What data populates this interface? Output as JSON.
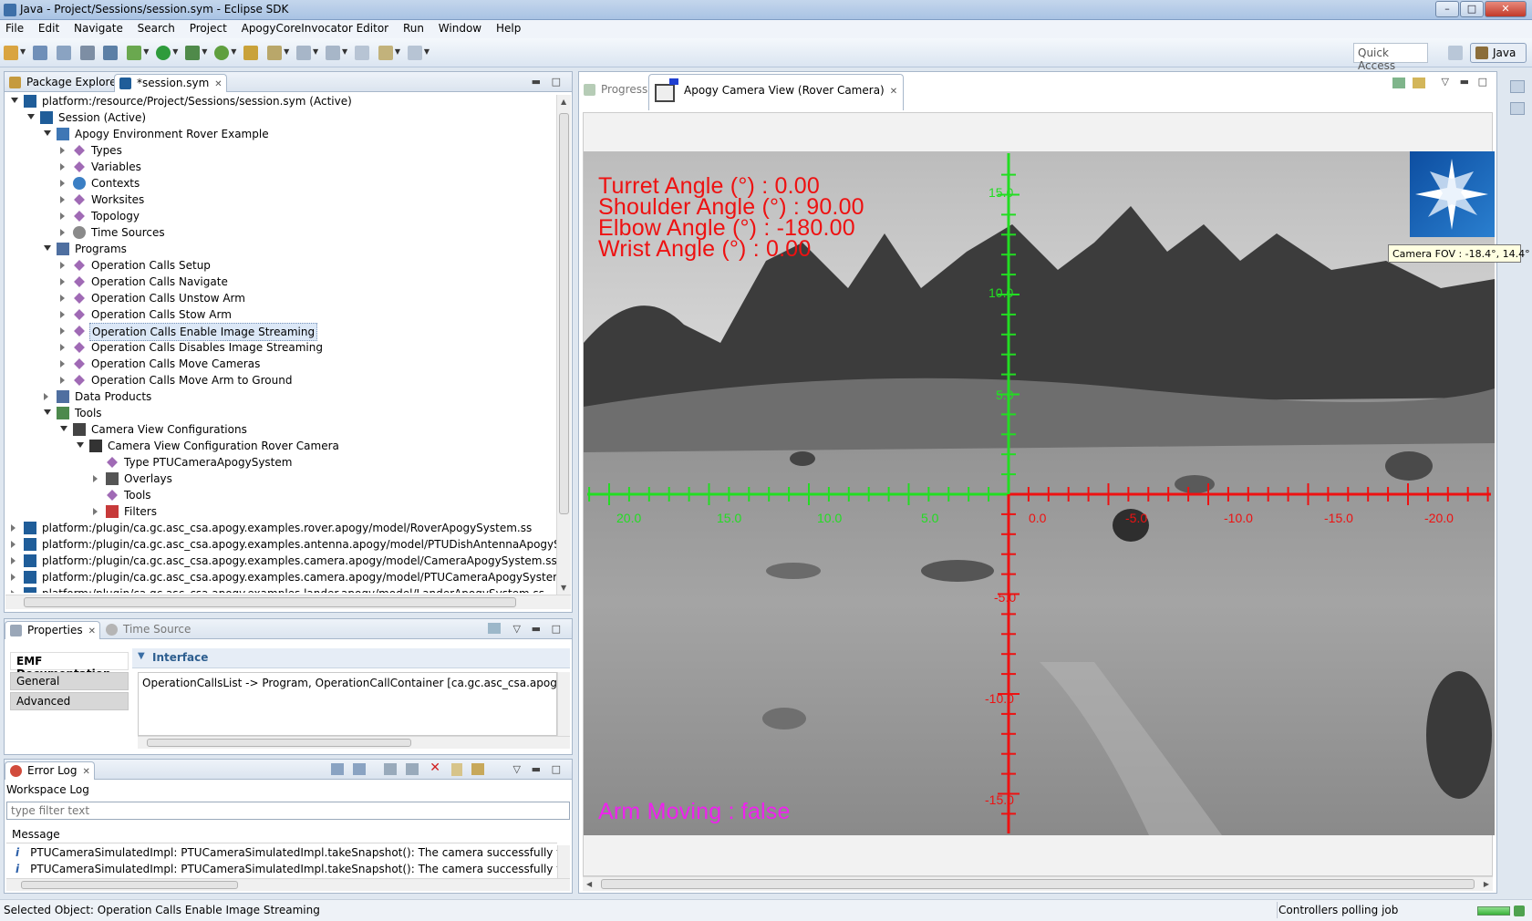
{
  "window": {
    "title": "Java - Project/Sessions/session.sym - Eclipse SDK",
    "min": "–",
    "max": "□",
    "close": "✕"
  },
  "menu": [
    "File",
    "Edit",
    "Navigate",
    "Search",
    "Project",
    "ApogyCoreInvocator Editor",
    "Run",
    "Window",
    "Help"
  ],
  "toolbar": {
    "quick_access": "Quick Access",
    "perspective": "Java"
  },
  "left_panel": {
    "tabs": [
      {
        "label": "Package Explorer"
      },
      {
        "label": "*session.sym"
      }
    ],
    "tree": [
      {
        "label": "platform:/resource/Project/Sessions/session.sym (Active)",
        "depth": 0,
        "state": "open",
        "icon": "apogy-icon"
      },
      {
        "label": "Session (Active)",
        "depth": 1,
        "state": "open",
        "icon": "apogy-icon"
      },
      {
        "label": "Apogy Environment Rover Example",
        "depth": 2,
        "state": "open",
        "icon": "environment-icon"
      },
      {
        "label": "Types",
        "depth": 3,
        "state": "closed",
        "icon": "diamond-icon"
      },
      {
        "label": "Variables",
        "depth": 3,
        "state": "closed",
        "icon": "diamond-icon"
      },
      {
        "label": "Contexts",
        "depth": 3,
        "state": "closed",
        "icon": "globe-icon"
      },
      {
        "label": "Worksites",
        "depth": 3,
        "state": "closed",
        "icon": "diamond-icon"
      },
      {
        "label": "Topology",
        "depth": 3,
        "state": "closed",
        "icon": "diamond-icon"
      },
      {
        "label": "Time Sources",
        "depth": 3,
        "state": "closed",
        "icon": "clock-icon"
      },
      {
        "label": "Programs",
        "depth": 2,
        "state": "open",
        "icon": "programs-icon"
      },
      {
        "label": "Operation Calls Setup",
        "depth": 3,
        "state": "closed",
        "icon": "diamond-icon"
      },
      {
        "label": "Operation Calls Navigate",
        "depth": 3,
        "state": "closed",
        "icon": "diamond-icon"
      },
      {
        "label": "Operation Calls Unstow Arm",
        "depth": 3,
        "state": "closed",
        "icon": "diamond-icon"
      },
      {
        "label": "Operation Calls Stow Arm",
        "depth": 3,
        "state": "closed",
        "icon": "diamond-icon"
      },
      {
        "label": "Operation Calls Enable Image Streaming",
        "depth": 3,
        "state": "closed",
        "icon": "diamond-icon",
        "selected": true
      },
      {
        "label": "Operation Calls Disables Image Streaming",
        "depth": 3,
        "state": "closed",
        "icon": "diamond-icon"
      },
      {
        "label": "Operation Calls Move Cameras",
        "depth": 3,
        "state": "closed",
        "icon": "diamond-icon"
      },
      {
        "label": "Operation Calls Move Arm to Ground",
        "depth": 3,
        "state": "closed",
        "icon": "diamond-icon"
      },
      {
        "label": "Data Products",
        "depth": 2,
        "state": "closed",
        "icon": "data-products-icon"
      },
      {
        "label": "Tools",
        "depth": 2,
        "state": "open",
        "icon": "tools-icon"
      },
      {
        "label": "Camera View Configurations",
        "depth": 3,
        "state": "open",
        "icon": "camera-config-icon"
      },
      {
        "label": "Camera View Configuration Rover Camera",
        "depth": 4,
        "state": "open",
        "icon": "camera-icon"
      },
      {
        "label": "Type PTUCameraApogySystem",
        "depth": 5,
        "state": "none",
        "icon": "diamond-icon"
      },
      {
        "label": "Overlays",
        "depth": 5,
        "state": "closed",
        "icon": "overlays-icon"
      },
      {
        "label": "Tools",
        "depth": 5,
        "state": "none",
        "icon": "diamond-icon"
      },
      {
        "label": "Filters",
        "depth": 5,
        "state": "closed",
        "icon": "filters-icon"
      },
      {
        "label": "platform:/plugin/ca.gc.asc_csa.apogy.examples.rover.apogy/model/RoverApogySystem.ss",
        "depth": 0,
        "state": "closed",
        "icon": "apogy-icon"
      },
      {
        "label": "platform:/plugin/ca.gc.asc_csa.apogy.examples.antenna.apogy/model/PTUDishAntennaApogySystem.ss",
        "depth": 0,
        "state": "closed",
        "icon": "apogy-icon"
      },
      {
        "label": "platform:/plugin/ca.gc.asc_csa.apogy.examples.camera.apogy/model/CameraApogySystem.ss",
        "depth": 0,
        "state": "closed",
        "icon": "apogy-icon"
      },
      {
        "label": "platform:/plugin/ca.gc.asc_csa.apogy.examples.camera.apogy/model/PTUCameraApogySystem.ss",
        "depth": 0,
        "state": "closed",
        "icon": "apogy-icon"
      },
      {
        "label": "platform:/plugin/ca.gc.asc_csa.apogy.examples.lander.apogy/model/LanderApogySystem.ss",
        "depth": 0,
        "state": "closed",
        "icon": "apogy-icon"
      }
    ]
  },
  "properties": {
    "tabs": [
      {
        "label": "Properties"
      },
      {
        "label": "Time Source"
      }
    ],
    "side_tabs": [
      "EMF Documentation",
      "General",
      "Advanced"
    ],
    "section_title": "Interface",
    "text": "OperationCallsList -> Program, OperationCallContainer [ca.gc.asc_csa.apogy.core.invo"
  },
  "error_log": {
    "tab": "Error Log",
    "workspace": "Workspace Log",
    "filter_placeholder": "type filter text",
    "column": "Message",
    "rows": [
      "PTUCameraSimulatedImpl: PTUCameraSimulatedImpl.takeSnapshot(): The camera successfully took and r",
      "PTUCameraSimulatedImpl: PTUCameraSimulatedImpl.takeSnapshot(): The camera successfully took and r"
    ]
  },
  "camera_view": {
    "tabs": [
      {
        "label": "Progress"
      },
      {
        "label": "Apogy Camera View (Rover Camera)"
      }
    ],
    "angles": [
      "Turret Angle (°) : 0.00",
      "Shoulder Angle (°) : 90.00",
      "Elbow Angle (°) : -180.00",
      "Wrist Angle (°) : 0.00"
    ],
    "arm_moving": "Arm Moving : false",
    "fov_tooltip": "Camera FOV : -18.4°, 14.4°",
    "x_ticks_green": [
      "20.0",
      "15.0",
      "10.0",
      "5.0"
    ],
    "x_ticks_red": [
      "0.0",
      "-5.0",
      "-10.0",
      "-15.0",
      "-20.0"
    ],
    "y_ticks_green": [
      "15.0",
      "10.0",
      "5.0"
    ],
    "y_ticks_red": [
      "-5.0",
      "-10.0",
      "-15.0"
    ],
    "colors": {
      "green": "#22dd22",
      "red": "#ee1111",
      "magenta": "#ee22ee"
    }
  },
  "status": {
    "selected": "Selected Object: Operation Calls Enable Image Streaming",
    "job": "Controllers polling job"
  }
}
